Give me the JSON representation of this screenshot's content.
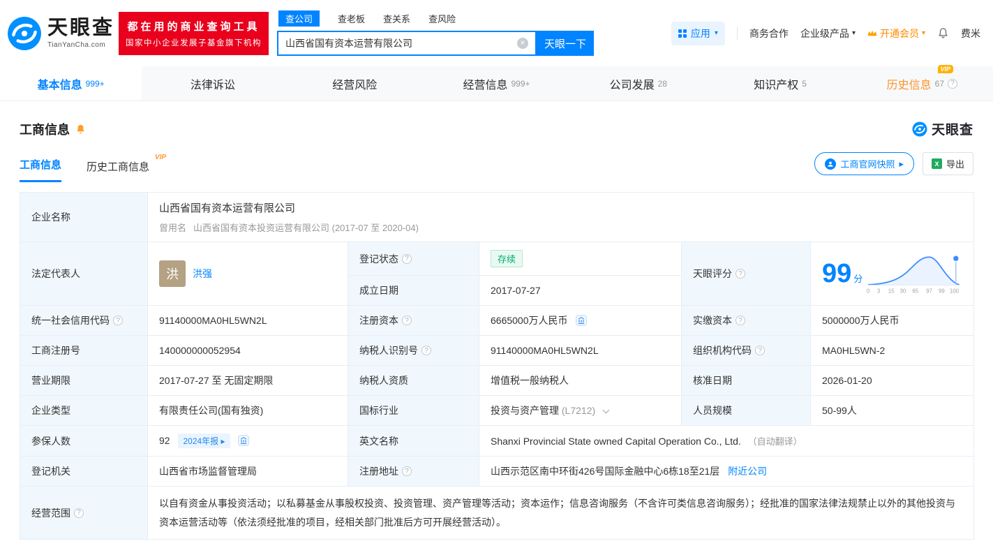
{
  "brand": {
    "logo_cn": "天眼查",
    "logo_en": "TianYanCha.com",
    "slogan_line1": "都在用的商业查询工具",
    "slogan_line2": "国家中小企业发展子基金旗下机构"
  },
  "search": {
    "tabs": [
      {
        "label": "查公司"
      },
      {
        "label": "查老板"
      },
      {
        "label": "查关系"
      },
      {
        "label": "查风险"
      }
    ],
    "value": "山西省国有资本运营有限公司",
    "button": "天眼一下"
  },
  "topnav": {
    "apps": "应用",
    "cooperation": "商务合作",
    "enterprise": "企业级产品",
    "vip": "开通会员",
    "username": "费米"
  },
  "nav_tabs": [
    {
      "label": "基本信息",
      "badge": "999+"
    },
    {
      "label": "法律诉讼",
      "badge": ""
    },
    {
      "label": "经营风险",
      "badge": ""
    },
    {
      "label": "经营信息",
      "badge": "999+"
    },
    {
      "label": "公司发展",
      "badge": "28"
    },
    {
      "label": "知识产权",
      "badge": "5"
    },
    {
      "label": "历史信息",
      "badge": "67",
      "vip": "VIP"
    }
  ],
  "section": {
    "title": "工商信息",
    "subtab_current": "工商信息",
    "subtab_history": "历史工商信息",
    "vip_tag": "VIP",
    "snapshot_button": "工商官网快照",
    "export_button": "导出",
    "logo_text": "天眼查"
  },
  "info": {
    "company_name_label": "企业名称",
    "company_name": "山西省国有资本运营有限公司",
    "former_name_label": "曾用名",
    "former_name": "山西省国有资本投资运营有限公司 (2017-07 至 2020-04)",
    "legal_rep_label": "法定代表人",
    "legal_rep_avatar": "洪",
    "legal_rep": "洪强",
    "reg_status_label": "登记状态",
    "reg_status": "存续",
    "establish_date_label": "成立日期",
    "establish_date": "2017-07-27",
    "score_label": "天眼评分",
    "score_value": "99",
    "score_unit": "分",
    "credit_code_label": "统一社会信用代码",
    "credit_code": "91140000MA0HL5WN2L",
    "reg_capital_label": "注册资本",
    "reg_capital": "6665000万人民币",
    "paid_capital_label": "实缴资本",
    "paid_capital": "5000000万人民币",
    "reg_number_label": "工商注册号",
    "reg_number": "140000000052954",
    "taxpayer_id_label": "纳税人识别号",
    "taxpayer_id": "91140000MA0HL5WN2L",
    "org_code_label": "组织机构代码",
    "org_code": "MA0HL5WN-2",
    "business_term_label": "营业期限",
    "business_term": "2017-07-27 至 无固定期限",
    "taxpayer_quality_label": "纳税人资质",
    "taxpayer_quality": "增值税一般纳税人",
    "approval_date_label": "核准日期",
    "approval_date": "2026-01-20",
    "company_type_label": "企业类型",
    "company_type": "有限责任公司(国有独资)",
    "industry_label": "国标行业",
    "industry": "投资与资产管理",
    "industry_code": "(L7212)",
    "staff_size_label": "人员规模",
    "staff_size": "50-99人",
    "insured_label": "参保人数",
    "insured": "92",
    "insured_badge": "2024年报",
    "english_name_label": "英文名称",
    "english_name": "Shanxi Provincial State owned Capital Operation Co., Ltd.",
    "english_name_note": "（自动翻译）",
    "reg_authority_label": "登记机关",
    "reg_authority": "山西省市场监督管理局",
    "reg_address_label": "注册地址",
    "reg_address": "山西示范区南中环街426号国际金融中心6栋18至21层",
    "nearby_link": "附近公司",
    "business_scope_label": "经营范围",
    "business_scope": "以自有资金从事投资活动；以私募基金从事股权投资、投资管理、资产管理等活动；资本运作；信息咨询服务（不含许可类信息咨询服务）；经批准的国家法律法规禁止以外的其他投资与资本运营活动等（依法须经批准的项目，经相关部门批准后方可开展经营活动）。"
  },
  "score_chart": {
    "type": "line",
    "score": 99,
    "x_ticks": [
      "0",
      "3",
      "15",
      "30",
      "65",
      "97",
      "99",
      "100"
    ],
    "marker_x": 99
  },
  "icons": {
    "help": "?",
    "caret": "▾",
    "clear": "×",
    "arrow": "▸",
    "excel": "X"
  }
}
